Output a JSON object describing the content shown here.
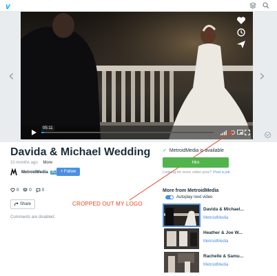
{
  "topbar": {
    "logo_text": "v"
  },
  "player": {
    "timestamp": "05:11",
    "prev_arrow": "‹",
    "next_arrow": "›"
  },
  "video": {
    "title": "Davida & Michael Wedding",
    "posted": "10 months ago",
    "more_label": "More",
    "owner_name": "MetroidMedia",
    "owner_badge": "PLUS",
    "follow_label": "+ Follow",
    "likes": "0",
    "collections": "0",
    "comments_count": "0",
    "share_label": "Share",
    "comments_disabled": "Comments are disabled."
  },
  "annotation": {
    "text": "CROPPED OUT MY LOGO",
    "color": "#e3461f"
  },
  "sidebar": {
    "availability": "MetroidMedia is available",
    "hire_label": "Hire",
    "looking_text": "Looking for more video pros?",
    "post_job_label": "Post a job",
    "more_from": "More from MetroidMedia",
    "autoplay_label": "Autoplay next video",
    "related": [
      {
        "title": "Davida & Michael...",
        "owner": "MetroidMedia"
      },
      {
        "title": "Heather & Joe W...",
        "owner": "MetroidMedia"
      },
      {
        "title": "Rachelle & Samu...",
        "owner": "MetroidMedia"
      }
    ]
  },
  "colors": {
    "accent": "#4a90e2",
    "hire": "#52b44d",
    "brand": "#00adef"
  }
}
